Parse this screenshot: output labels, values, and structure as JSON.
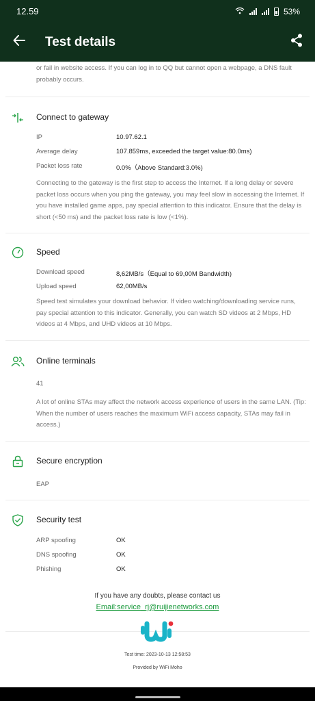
{
  "status": {
    "time": "12.59",
    "battery": "53%"
  },
  "app_bar": {
    "title": "Test details"
  },
  "dns_section": {
    "desc_tail": "or fail in website access. If you can log in to QQ but cannot open a webpage, a DNS fault probably occurs."
  },
  "gateway": {
    "title": "Connect to gateway",
    "rows": [
      {
        "label": "IP",
        "value": "10.97.62.1"
      },
      {
        "label": "Average delay",
        "value": "107.859ms, exceeded the target value:80.0ms)"
      },
      {
        "label": "Packet loss rate",
        "value": "0.0%（Above Standard:3.0%)"
      }
    ],
    "desc": "Connecting to the gateway is the first step to access the Internet. If a long delay or severe packet loss occurs when you ping the gateway, you may feel slow in accessing the Internet. If you have installed game apps, pay special attention to this indicator. Ensure that the delay is short (<50 ms) and the packet loss rate is low (<1%)."
  },
  "speed": {
    "title": "Speed",
    "rows": [
      {
        "label": "Download speed",
        "value": "8,62MB/s（Equal to 69,00M Bandwidth)"
      },
      {
        "label": "Upload speed",
        "value": "62,00MB/s"
      }
    ],
    "desc": "Speed test simulates your download behavior. If video watching/downloading service runs, pay special attention to this indicator. Generally, you can watch SD videos at 2 Mbps, HD videos at 4 Mbps, and UHD videos at 10 Mbps."
  },
  "terminals": {
    "title": "Online terminals",
    "value": "41",
    "desc": "A lot of online STAs may affect the network access experience of users in the same LAN. (Tip: When the number of users reaches the maximum WiFi access capacity, STAs may fail in access.)"
  },
  "encryption": {
    "title": "Secure encryption",
    "value": "EAP"
  },
  "security": {
    "title": "Security test",
    "rows": [
      {
        "label": "ARP spoofing",
        "value": "OK"
      },
      {
        "label": "DNS spoofing",
        "value": "OK"
      },
      {
        "label": "Phishing",
        "value": "OK"
      }
    ]
  },
  "footer": {
    "contact": "If you have any doubts, please contact us",
    "email": "Email:service_rj@ruijienetworks.com",
    "test_time": "Test time: 2023-10-13 12:58:53",
    "provided_by": "Provided by WiFi Moho"
  },
  "colors": {
    "header_bg": "#10301c",
    "accent": "#1a9a3c",
    "logo_teal": "#1ab4c8",
    "logo_red": "#e8303a"
  }
}
